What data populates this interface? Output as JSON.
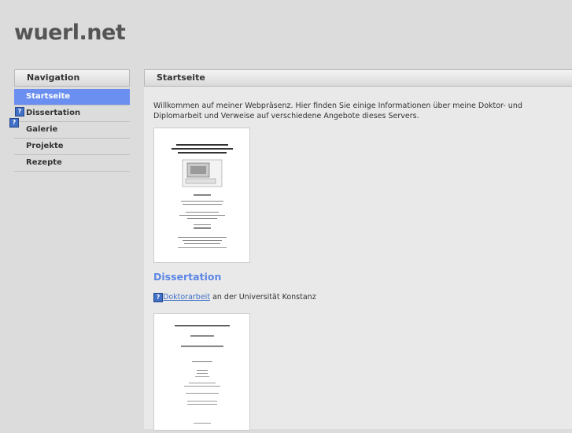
{
  "site": {
    "title": "wuerl.net"
  },
  "sidebar": {
    "header": "Navigation",
    "items": [
      {
        "label": "Startseite",
        "active": true
      },
      {
        "label": "Dissertation"
      },
      {
        "label": "Galerie"
      },
      {
        "label": "Projekte"
      },
      {
        "label": "Rezepte"
      }
    ],
    "icons": [
      "help-icon",
      "help-icon"
    ]
  },
  "main": {
    "header": "Startseite",
    "intro": "Willkommen auf meiner Webpräsenz. Hier finden Sie einige Informationen über meine Doktor- und Diplomarbeit und Verweise auf verschiedene Angebote dieses Servers.",
    "section_title": "Dissertation",
    "link_text": "Doktorarbeit",
    "link_suffix": " an der Universität Konstanz"
  },
  "colors": {
    "accent": "#6b8ff0",
    "link": "#3f6fc6",
    "heading": "#5d87e6"
  }
}
